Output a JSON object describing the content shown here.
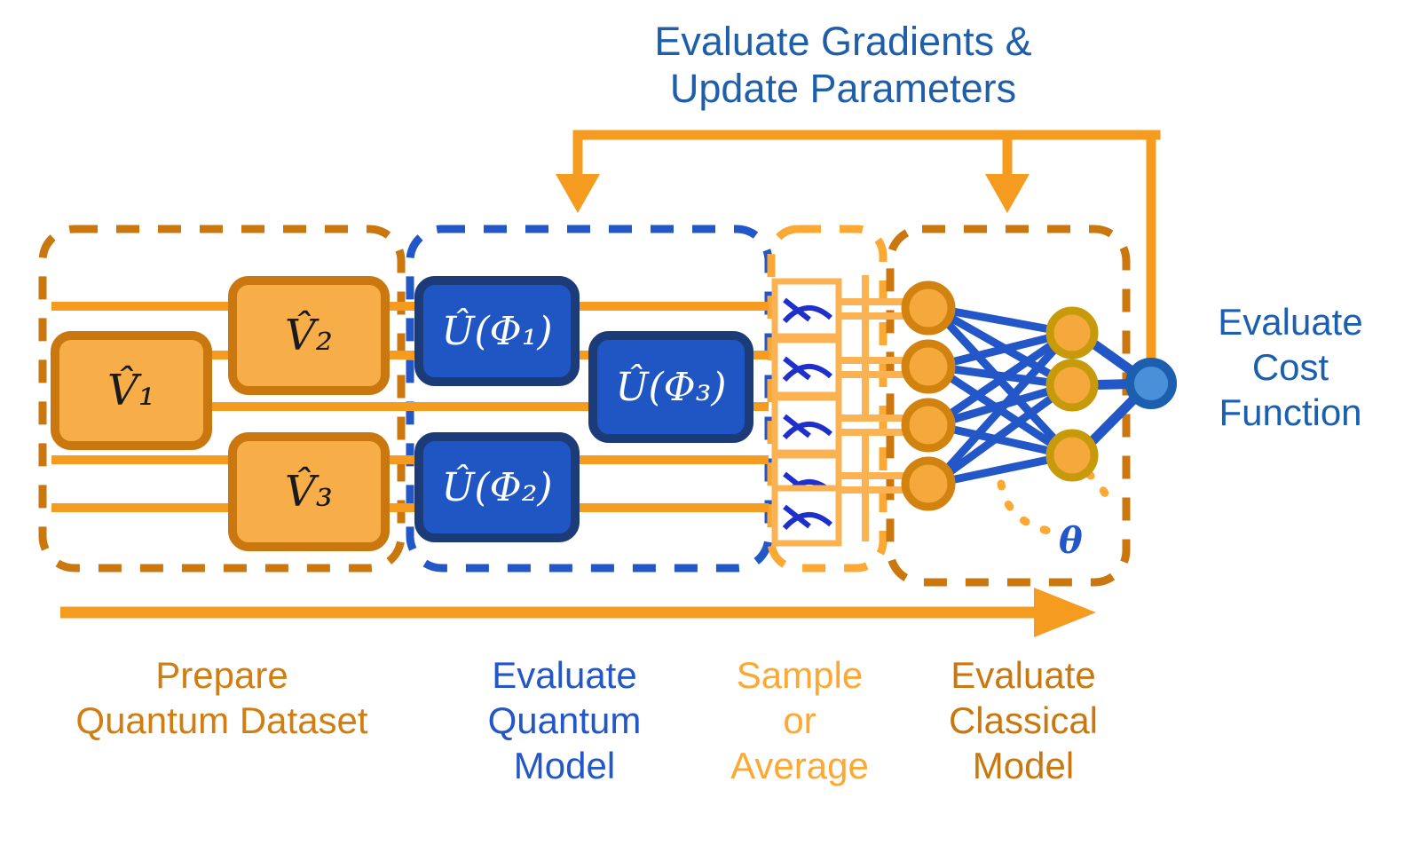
{
  "title": {
    "line1": "Evaluate Gradients &",
    "line2": "Update Parameters"
  },
  "colors": {
    "wire_orange": "#F59B20",
    "wire_light_orange": "#FBB košt",
    "light_orange": "#FBB040",
    "dark_orange": "#C77414",
    "mid_orange": "#E08A18",
    "blue": "#1F56C4",
    "dark_blue": "#1B3C78",
    "label_blue": "#1B5FAE",
    "node_olive": "#C79A0C",
    "node_fill": "#F5A93C",
    "output_fill": "#4A90D9",
    "output_ring": "#1B5FAE"
  },
  "stages": [
    {
      "id": "prepare",
      "label": "Prepare\nQuantum Dataset",
      "color": "#D07D12"
    },
    {
      "id": "quantum-model",
      "label": "Evaluate\nQuantum\nModel",
      "color": "#2356C6"
    },
    {
      "id": "sample",
      "label": "Sample\nor\nAverage",
      "color": "#FBA834"
    },
    {
      "id": "classical-model",
      "label": "Evaluate\nClassical\nModel",
      "color": "#C9770E"
    }
  ],
  "cost_label": "Evaluate\nCost\nFunction",
  "dataset_gates": [
    {
      "id": "v1",
      "label": "V̂₁",
      "sym": "V",
      "sub": "1"
    },
    {
      "id": "v2",
      "label": "V̂₂",
      "sym": "V",
      "sub": "2"
    },
    {
      "id": "v3",
      "label": "V̂₃",
      "sym": "V",
      "sub": "3"
    }
  ],
  "model_gates": [
    {
      "id": "u1",
      "label": "Û(Φ₁)",
      "sym": "U",
      "sub": "1"
    },
    {
      "id": "u2",
      "label": "Û(Φ₂)",
      "sym": "U",
      "sub": "2"
    },
    {
      "id": "u3",
      "label": "Û(Φ₃)",
      "sym": "U",
      "sub": "3"
    }
  ],
  "measurements": {
    "count": 5,
    "icon": "gauge-meter-icon"
  },
  "network": {
    "input_nodes": 4,
    "hidden_nodes": 3,
    "output_nodes": 1,
    "parameter_symbol": "θ"
  },
  "qubit_wires": 5,
  "flow_arrow": "progress-arrow-right",
  "feedback_arrows": 2
}
